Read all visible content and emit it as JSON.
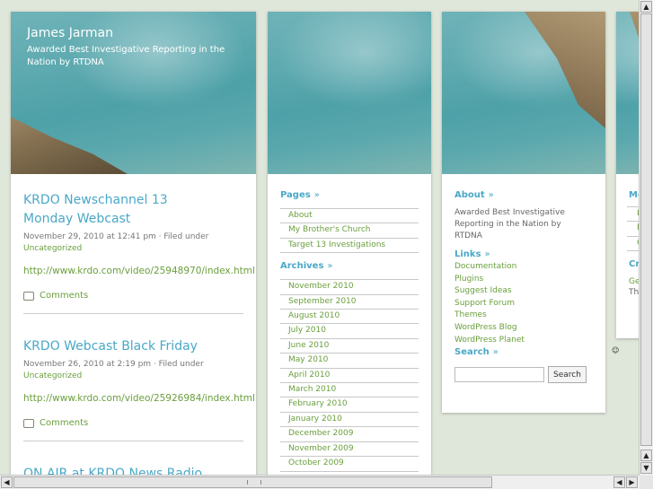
{
  "site": {
    "title": "James Jarman",
    "description": "Awarded Best Investigative Reporting in the Nation by RTDNA"
  },
  "posts": [
    {
      "title": "KRDO Newschannel 13 Monday Webcast",
      "meta": "November 29, 2010 at 12:41 pm · Filed under",
      "category": "Uncategorized",
      "link": "http://www.krdo.com/video/25948970/index.html",
      "comments": "Comments"
    },
    {
      "title": "KRDO Webcast Black Friday",
      "meta": "November 26, 2010 at 2:19 pm · Filed under",
      "category": "Uncategorized",
      "link": "http://www.krdo.com/video/25926984/index.html",
      "comments": "Comments"
    },
    {
      "title": "ON AIR at KRDO News Radio"
    }
  ],
  "pages_widget": {
    "title": "Pages",
    "items": [
      "About",
      "My Brother's Church",
      "Target 13 Investigations"
    ]
  },
  "archives_widget": {
    "title": "Archives",
    "items": [
      "November 2010",
      "September 2010",
      "August 2010",
      "July 2010",
      "June 2010",
      "May 2010",
      "April 2010",
      "March 2010",
      "February 2010",
      "January 2010",
      "December 2009",
      "November 2009",
      "October 2009"
    ]
  },
  "about_widget": {
    "title": "About",
    "text": "Awarded Best Investigative Reporting in the Nation by RTDNA"
  },
  "links_widget": {
    "title": "Links",
    "items": [
      "Documentation",
      "Plugins",
      "Suggest Ideas",
      "Support Forum",
      "Themes",
      "WordPress Blog",
      "WordPress Planet"
    ]
  },
  "search_widget": {
    "title": "Search",
    "input_value": "",
    "button_label": "Search"
  },
  "partial_column": {
    "heading1": "Me",
    "items1": [
      "L",
      "B",
      "C"
    ],
    "heading2": "Cr",
    "text_lines": [
      "Ge",
      "The"
    ]
  },
  "colors": {
    "link_blue": "#4aa8c7",
    "link_green": "#6a9f3c",
    "page_bg": "#dfe6da"
  }
}
